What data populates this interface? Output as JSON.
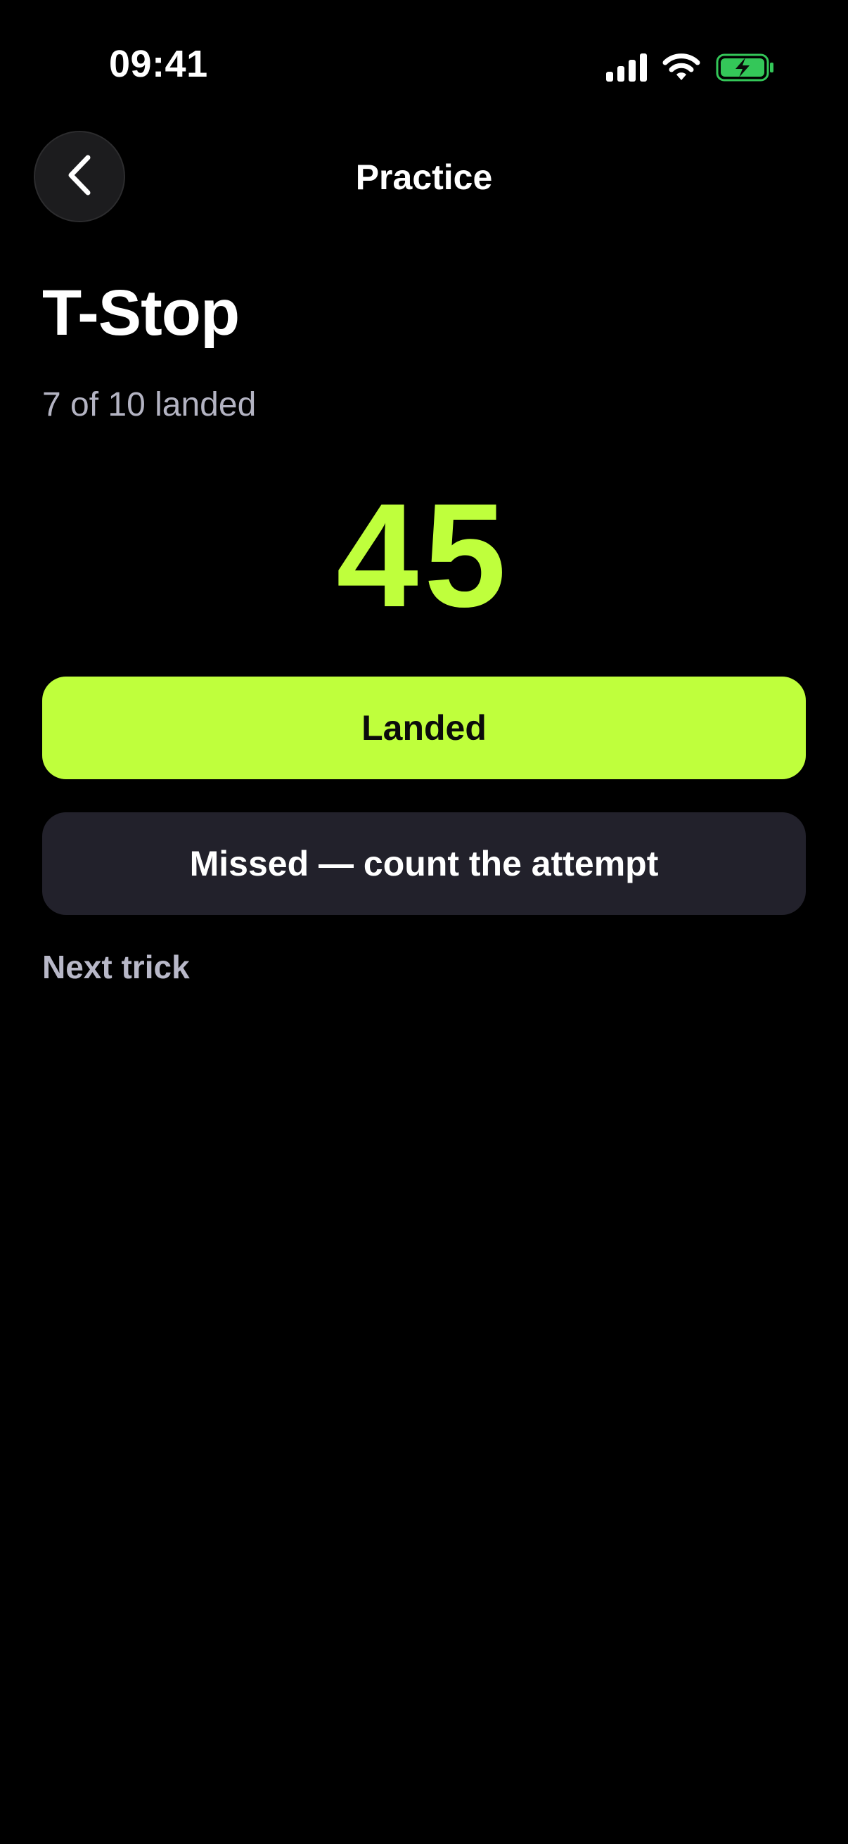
{
  "status_bar": {
    "time": "09:41",
    "icons": [
      "cellular-signal-icon",
      "wifi-icon",
      "battery-charging-icon"
    ],
    "battery_color": "#34c759"
  },
  "nav": {
    "back_icon": "chevron-left-icon",
    "title": "Practice"
  },
  "trick": {
    "name": "T-Stop",
    "progress_text": "7 of 10 landed",
    "landed": 7,
    "total": 10,
    "score": "45"
  },
  "actions": {
    "landed_label": "Landed",
    "missed_label": "Missed — count the attempt",
    "next_label": "Next trick"
  },
  "colors": {
    "accent": "#bfff3c",
    "background": "#000000",
    "secondary_button": "#22212b",
    "muted_text": "#b3b3c2"
  }
}
